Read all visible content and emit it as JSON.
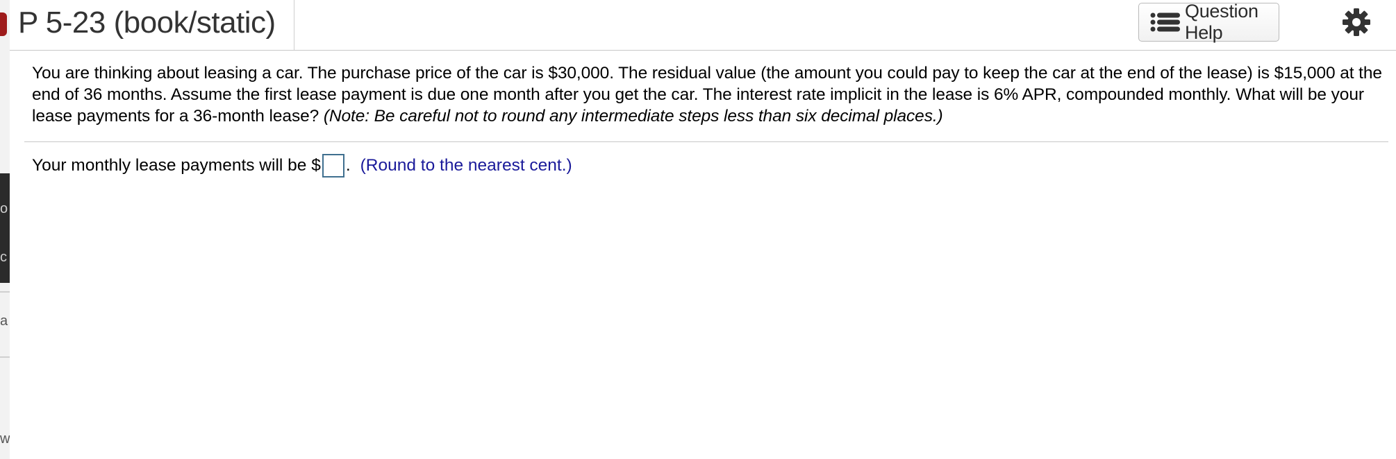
{
  "header": {
    "title": "P 5-23 (book/static)",
    "help_button_label": "Question Help",
    "help_icon": "list-icon",
    "settings_icon": "gear-icon"
  },
  "question": {
    "text": "You are thinking about leasing a car. The purchase price of the car is $30,000. The residual value (the amount you could pay to keep the car at the end of the lease) is $15,000 at the end of 36 months. Assume the first lease payment is due one month after you get the car. The interest rate implicit in the lease is 6% APR, compounded monthly. What will be your lease payments for a 36-month lease?",
    "note": "(Note: Be careful not to round any intermediate steps less than six decimal places.)"
  },
  "answer": {
    "prompt": "Your monthly lease payments will be $",
    "value": "",
    "suffix": ".",
    "hint": "(Round to the nearest cent.)"
  },
  "colors": {
    "hint_text": "#1a1a9a",
    "input_border": "#3f6f8f",
    "title_text": "#333333"
  }
}
